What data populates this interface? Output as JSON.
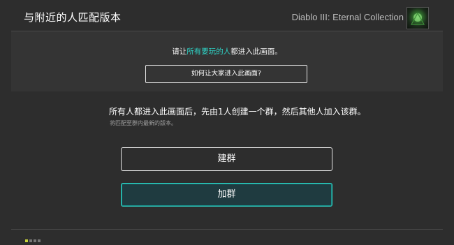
{
  "header": {
    "title": "与附近的人匹配版本",
    "game_title": "Diablo III: Eternal Collection",
    "game_icon": "diablo-game-icon"
  },
  "panel": {
    "instruction_prefix": "请让",
    "instruction_highlight": "所有要玩的人",
    "instruction_suffix": "都进入此画面。",
    "how_button_label": "如何让大家进入此画面?"
  },
  "main": {
    "description": "所有人都进入此画面后，先由1人创建一个群，然后其他人加入该群。",
    "subnote": "将匹配至群内最新的版本。",
    "create_group_label": "建群",
    "join_group_label": "加群"
  },
  "colors": {
    "accent": "#2ed3c6",
    "background": "#2d2d2d"
  }
}
